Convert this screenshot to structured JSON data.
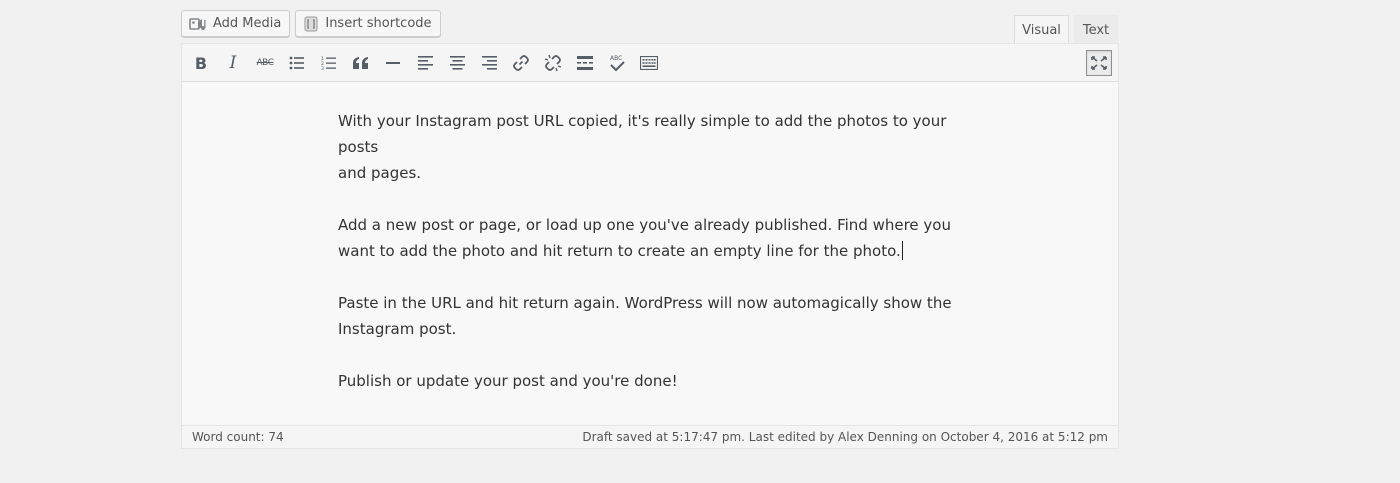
{
  "media_buttons": {
    "add_media": "Add Media",
    "insert_shortcode": "Insert shortcode"
  },
  "editor_tabs": {
    "visual": "Visual",
    "text": "Text"
  },
  "toolbar": {
    "buttons": [
      {
        "name": "bold-icon",
        "label": "B"
      },
      {
        "name": "italic-icon",
        "label": "I"
      },
      {
        "name": "strikethrough-icon",
        "label": "ABC"
      },
      {
        "name": "bulleted-list-icon"
      },
      {
        "name": "numbered-list-icon"
      },
      {
        "name": "blockquote-icon"
      },
      {
        "name": "horizontal-line-icon"
      },
      {
        "name": "align-left-icon"
      },
      {
        "name": "align-center-icon"
      },
      {
        "name": "align-right-icon"
      },
      {
        "name": "insert-link-icon"
      },
      {
        "name": "remove-link-icon"
      },
      {
        "name": "read-more-icon"
      },
      {
        "name": "spellcheck-icon",
        "label": "ABC"
      },
      {
        "name": "toolbar-toggle-icon"
      },
      {
        "name": "fullscreen-icon"
      }
    ]
  },
  "content": {
    "paragraphs": [
      "With your Instagram post URL copied, it's really simple to add the photos to your posts\nand pages.",
      "Add a new post or page, or load up one you've already published. Find where you\nwant to add the photo and hit return to create an empty line for the photo.",
      "Paste in the URL and hit return again. WordPress will now automagically show the\nInstagram post.",
      "Publish or update your post and you're done!"
    ]
  },
  "status": {
    "word_count": "Word count: 74",
    "draft_saved": "Draft saved at 5:17:47 pm. Last edited by Alex Denning on October 4, 2016 at 5:12 pm"
  }
}
